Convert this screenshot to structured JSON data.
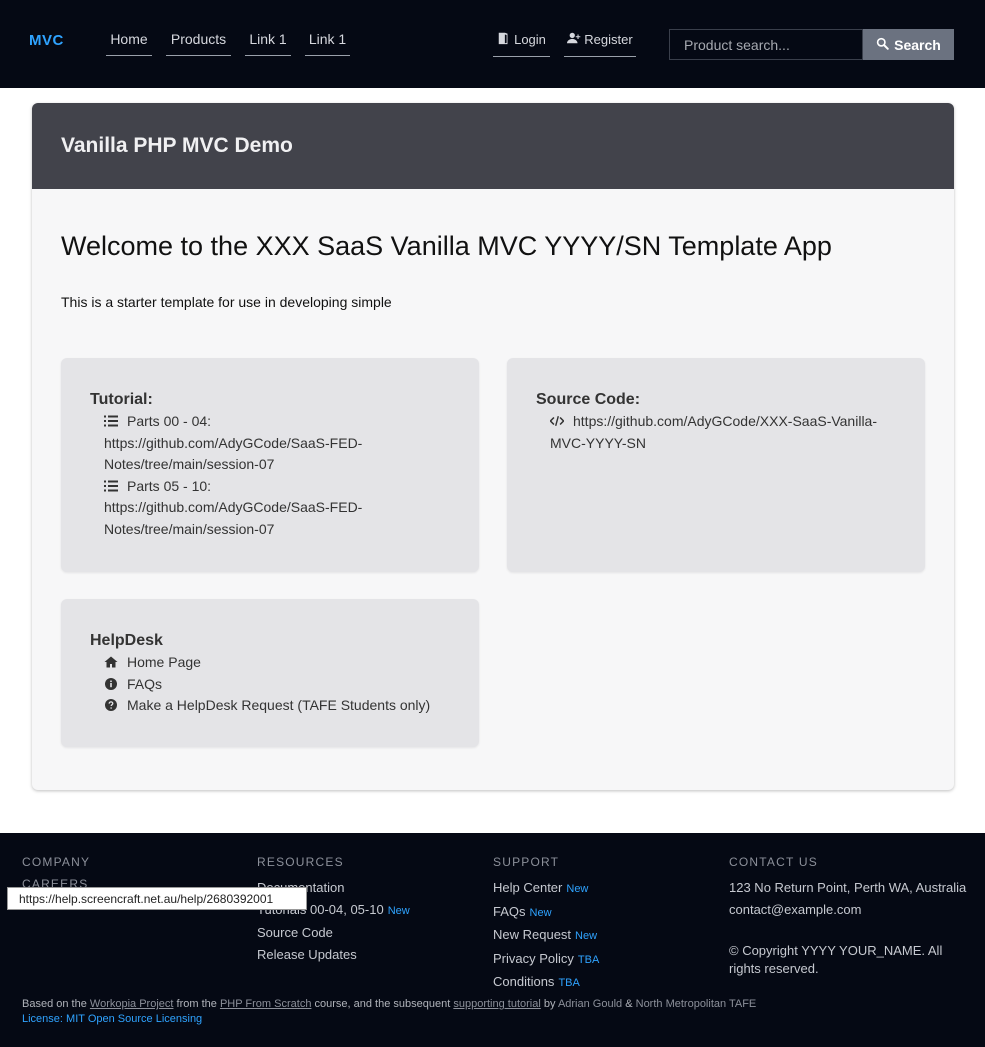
{
  "nav": {
    "brand": "MVC",
    "links": [
      "Home",
      "Products",
      "Link 1",
      "Link 1"
    ],
    "login": "Login",
    "register": "Register",
    "search_placeholder": "Product search...",
    "search_button": "Search"
  },
  "card": {
    "header_title": "Vanilla PHP MVC Demo",
    "welcome": "Welcome to the XXX SaaS Vanilla MVC YYYY/SN Template App",
    "intro": "This is a starter template for use in developing simple"
  },
  "tutorial": {
    "title": "Tutorial:",
    "items": [
      {
        "icon": "list-icon",
        "label": "Parts 00 - 04: https://github.com/AdyGCode/SaaS-FED-Notes/tree/main/session-07"
      },
      {
        "icon": "list-icon",
        "label": "Parts 05 - 10: https://github.com/AdyGCode/SaaS-FED-Notes/tree/main/session-07"
      }
    ]
  },
  "source": {
    "title": "Source Code:",
    "items": [
      {
        "icon": "code-icon",
        "label": "https://github.com/AdyGCode/XXX-SaaS-Vanilla-MVC-YYYY-SN"
      }
    ]
  },
  "helpdesk": {
    "title": "HelpDesk",
    "items": [
      {
        "icon": "home-icon",
        "label": "Home Page"
      },
      {
        "icon": "info-icon",
        "label": "FAQs"
      },
      {
        "icon": "question-icon",
        "label": "Make a HelpDesk Request (TAFE Students only)"
      }
    ]
  },
  "footer": {
    "company": {
      "heading": "COMPANY",
      "items": [
        "CAREERS"
      ]
    },
    "resources": {
      "heading": "RESOURCES",
      "items": [
        {
          "label": "Documentation",
          "badge": ""
        },
        {
          "label": "Tutorials 00-04, 05-10",
          "badge": "New"
        },
        {
          "label": "Source Code",
          "badge": ""
        },
        {
          "label": "Release Updates",
          "badge": ""
        }
      ]
    },
    "support": {
      "heading": "SUPPORT",
      "items": [
        {
          "label": "Help Center",
          "badge": "New"
        },
        {
          "label": "FAQs",
          "badge": "New"
        },
        {
          "label": "New Request",
          "badge": "New"
        },
        {
          "label": "Privacy Policy",
          "badge": "TBA"
        },
        {
          "label": "Conditions",
          "badge": "TBA"
        }
      ]
    },
    "contact": {
      "heading": "CONTACT US",
      "address": "123 No Return Point, Perth WA, Australia",
      "email": "contact@example.com",
      "copyright": "© Copyright YYYY YOUR_NAME. All rights reserved."
    },
    "credits": {
      "based_on": "Based on the",
      "workopia": "Workopia Project",
      "from_the": "from the",
      "php_course": "PHP From Scratch",
      "course_text": "course, and the subsequent",
      "supporting": "supporting tutorial",
      "by": "by",
      "author": "Adrian Gould",
      "amp": "&",
      "org": "North Metropolitan TAFE"
    },
    "license": "License: MIT Open Source Licensing"
  },
  "tooltip": "https://help.screencraft.net.au/help/2680392001"
}
